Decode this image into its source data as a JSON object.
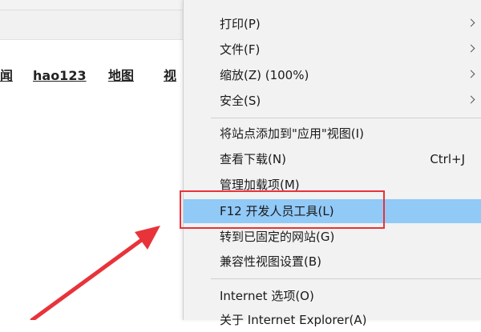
{
  "nav_links": [
    "闻",
    "hao123",
    "地图",
    "视"
  ],
  "menu": {
    "items": [
      {
        "label": "打印(P)",
        "has_submenu": true
      },
      {
        "label": "文件(F)",
        "has_submenu": true
      },
      {
        "label": "缩放(Z) (100%)",
        "has_submenu": true
      },
      {
        "label": "安全(S)",
        "has_submenu": true
      },
      {
        "label": "将站点添加到\"应用\"视图(I)"
      },
      {
        "label": "查看下载(N)",
        "shortcut": "Ctrl+J"
      },
      {
        "label": "管理加载项(M)"
      },
      {
        "label": "F12 开发人员工具(L)",
        "highlighted": true
      },
      {
        "label": "转到已固定的网站(G)"
      },
      {
        "label": "兼容性视图设置(B)"
      },
      {
        "label": "Internet 选项(O)"
      },
      {
        "label": "关于 Internet Explorer(A)"
      }
    ]
  },
  "colors": {
    "menu_bg": "#f2f2f2",
    "highlight": "#91c9f7",
    "annotation_red": "#e8333a"
  },
  "icons": [
    "chevron-right-icon",
    "red-arrow-icon"
  ]
}
